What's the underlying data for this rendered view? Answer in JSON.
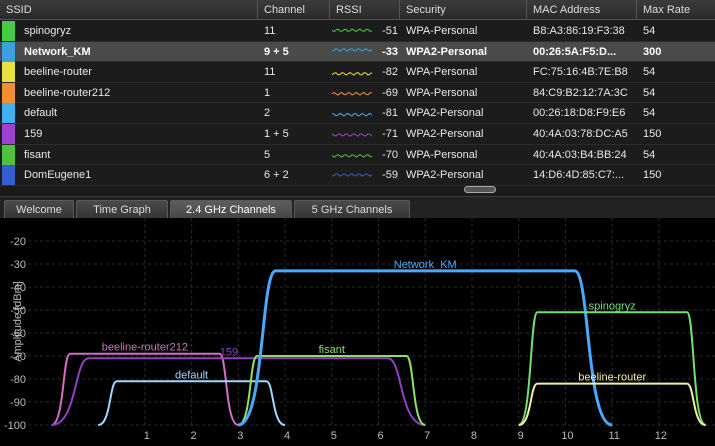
{
  "table": {
    "columns": [
      "SSID",
      "Channel",
      "RSSI",
      "Security",
      "MAC Address",
      "Max Rate"
    ],
    "rows": [
      {
        "ssid": "spinogryz",
        "channel": "11",
        "rssi": "-51",
        "security": "WPA-Personal",
        "mac": "B8:A3:86:19:F3:38",
        "rate": "54",
        "color": "#44cc44"
      },
      {
        "ssid": "Network_KM",
        "channel": "9 + 5",
        "rssi": "-33",
        "security": "WPA2-Personal",
        "mac": "00:26:5A:F5:D...",
        "rate": "300",
        "color": "#3aa0e0"
      },
      {
        "ssid": "beeline-router",
        "channel": "11",
        "rssi": "-82",
        "security": "WPA-Personal",
        "mac": "FC:75:16:4B:7E:B8",
        "rate": "54",
        "color": "#e8e040"
      },
      {
        "ssid": "beeline-router212",
        "channel": "1",
        "rssi": "-69",
        "security": "WPA-Personal",
        "mac": "84:C9:B2:12:7A:3C",
        "rate": "54",
        "color": "#f09030"
      },
      {
        "ssid": "default",
        "channel": "2",
        "rssi": "-81",
        "security": "WPA2-Personal",
        "mac": "00:26:18:D8:F9:E6",
        "rate": "54",
        "color": "#40b0f0"
      },
      {
        "ssid": "159",
        "channel": "1 + 5",
        "rssi": "-71",
        "security": "WPA2-Personal",
        "mac": "40:4A:03:78:DC:A5",
        "rate": "150",
        "color": "#a040d0"
      },
      {
        "ssid": "fisant",
        "channel": "5",
        "rssi": "-70",
        "security": "WPA-Personal",
        "mac": "40:4A:03:B4:BB:24",
        "rate": "54",
        "color": "#50c040"
      },
      {
        "ssid": "DomEugene1",
        "channel": "6 + 2",
        "rssi": "-59",
        "security": "WPA2-Personal",
        "mac": "14:D6:4D:85:C7:...",
        "rate": "150",
        "color": "#3060d0"
      }
    ],
    "selected_index": 1
  },
  "tabs": [
    {
      "label": "Welcome"
    },
    {
      "label": "Time Graph"
    },
    {
      "label": "2.4 GHz Channels",
      "active": true
    },
    {
      "label": "5 GHz Channels"
    }
  ],
  "chart_data": {
    "type": "area",
    "ylabel": "Amplitude [dBm]",
    "ylim": [
      -100,
      -10
    ],
    "yticks": [
      -20,
      -30,
      -40,
      -50,
      -60,
      -70,
      -80,
      -90,
      -100
    ],
    "xlim": [
      -1.5,
      13.2
    ],
    "xticks": [
      1,
      2,
      3,
      4,
      5,
      6,
      7,
      8,
      9,
      10,
      11,
      12
    ],
    "series": [
      {
        "name": "beeline-router212",
        "center": 1,
        "width": 2,
        "amplitude": -69,
        "color": "#d070c0",
        "label_pos": "top-left"
      },
      {
        "name": "159",
        "center": 3,
        "width": 4,
        "amplitude": -71,
        "color": "#9040c0",
        "hidden_label_x": 2.8
      },
      {
        "name": "default",
        "center": 2,
        "width": 2,
        "amplitude": -81,
        "color": "#a0d8ff"
      },
      {
        "name": "fisant",
        "center": 5,
        "width": 2,
        "amplitude": -70,
        "color": "#90e060"
      },
      {
        "name": "Network_KM",
        "center": 7,
        "width": 4,
        "amplitude": -33,
        "color": "#4aa8ff"
      },
      {
        "name": "spinogryz",
        "center": 11,
        "width": 2,
        "amplitude": -51,
        "color": "#70e070"
      },
      {
        "name": "beeline-router",
        "center": 11,
        "width": 2,
        "amplitude": -82,
        "color": "#f0f0a0"
      }
    ]
  }
}
